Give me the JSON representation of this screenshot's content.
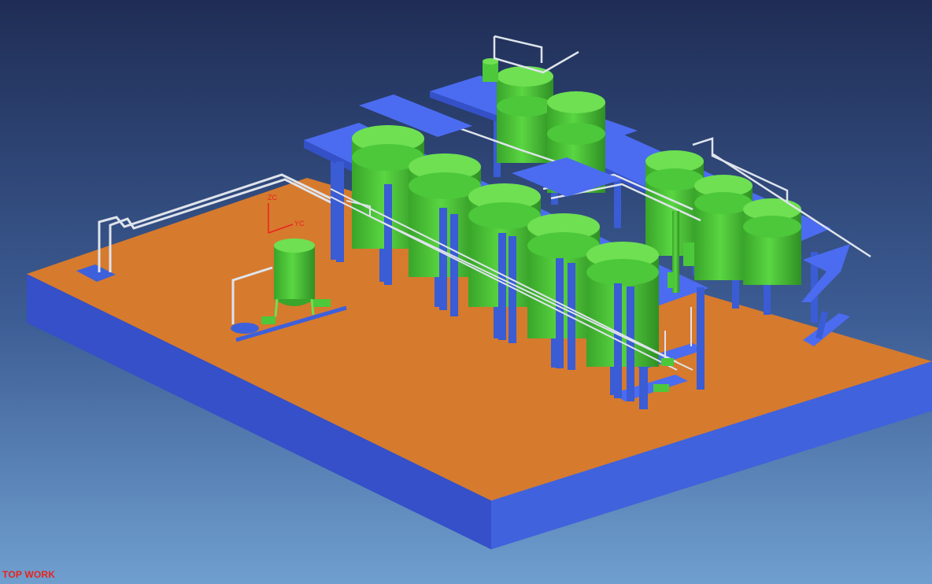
{
  "viewport": {
    "view_label": "TOP WORK",
    "axis": {
      "z_label": "ZC",
      "y_label": "YC"
    },
    "colors": {
      "background_top": "#1f2d55",
      "background_bottom": "#6f9fcf",
      "slab_top": "#d97a2c",
      "slab_side": "#3b5fd6",
      "steel": "#4169e1",
      "tank": "#4cc83a",
      "tank_top": "#6ee052",
      "pipe": "#d8dde6",
      "axis": "#e8241c"
    },
    "objects": [
      "concrete-slab",
      "steel-platform-front",
      "steel-platform-rear",
      "storage-tank",
      "vertical-vessel",
      "pump",
      "pipe-rack",
      "sump-pit"
    ]
  }
}
